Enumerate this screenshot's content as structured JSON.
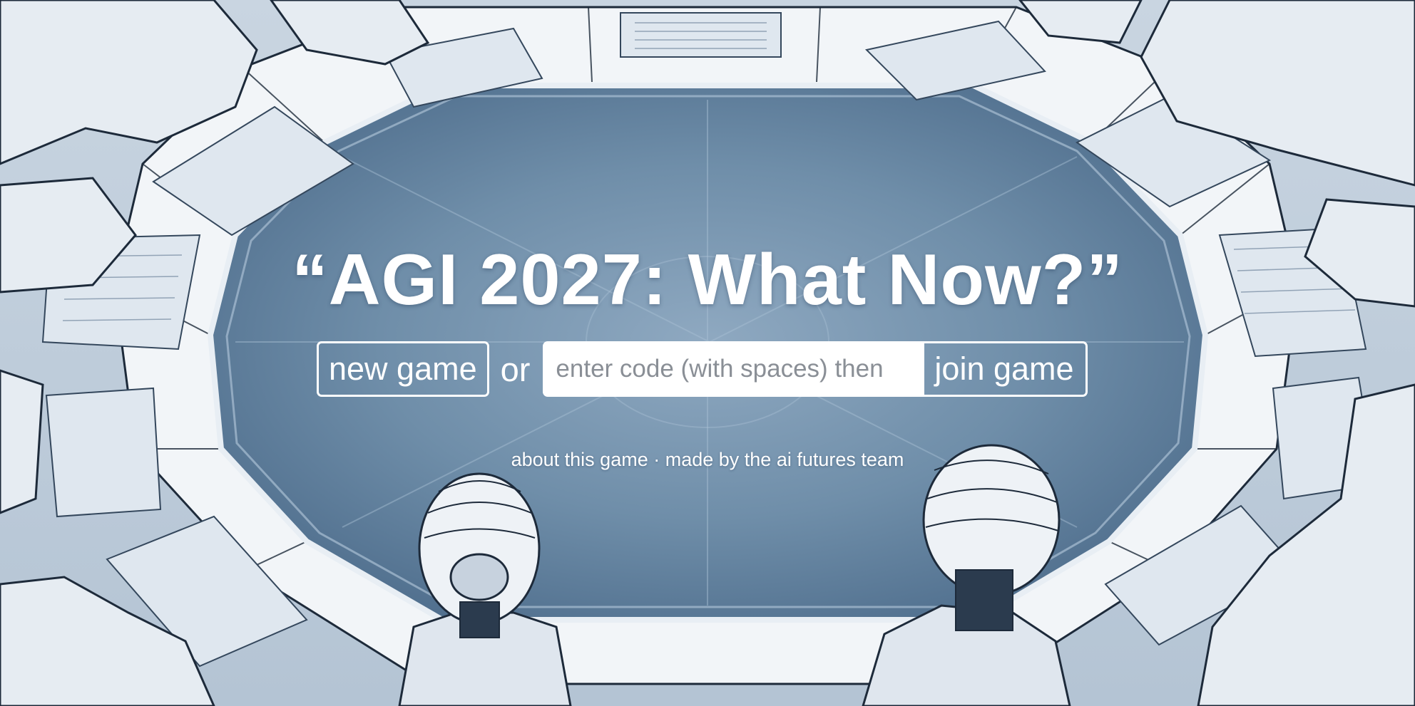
{
  "title": "“AGI 2027: What Now?”",
  "actions": {
    "new_game_label": "new game",
    "or_label": "or",
    "code_placeholder": "enter code (with spaces) then",
    "code_value": "",
    "join_game_label": "join game"
  },
  "footer": {
    "about_label": "about this game",
    "separator": " · ",
    "credit_label": "made by the ai futures team"
  },
  "background": {
    "description_icon": "robot-roundtable-illustration",
    "colors": {
      "table_center": "#7d9ab5",
      "table_rim": "#f4f7fa",
      "ink": "#1d2a3a"
    }
  }
}
